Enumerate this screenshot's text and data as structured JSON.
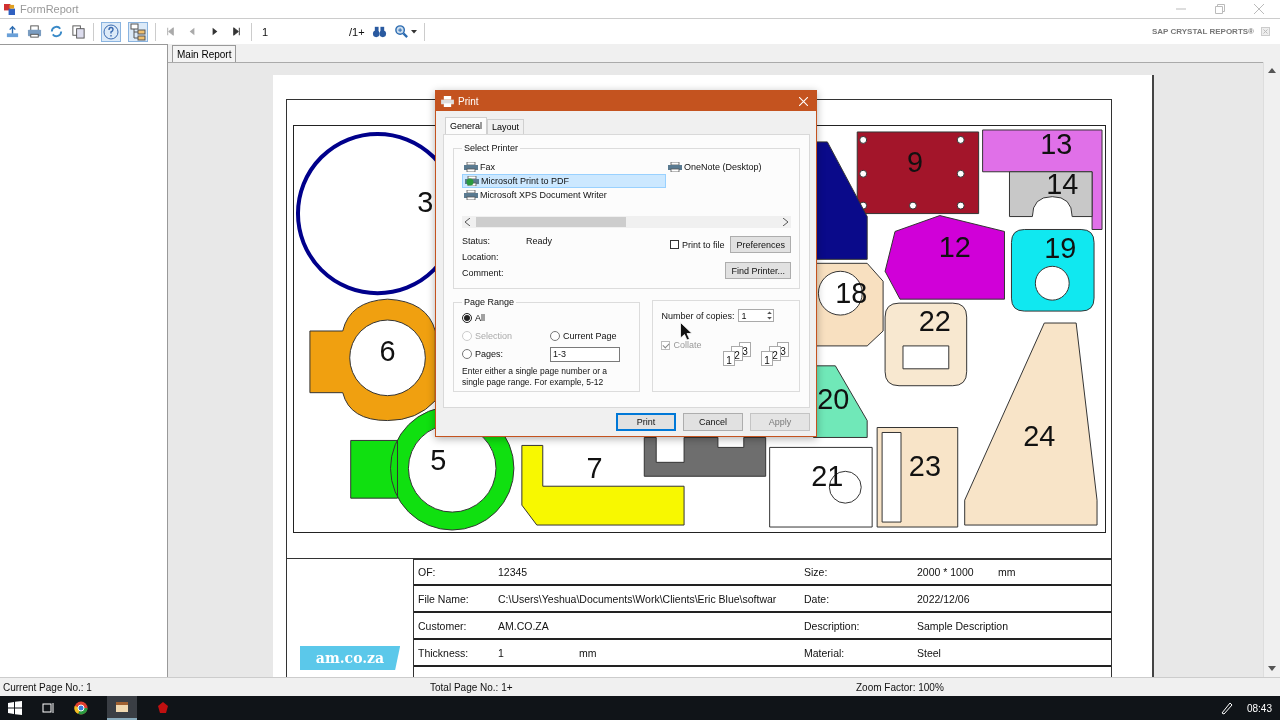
{
  "window": {
    "title": "FormReport"
  },
  "toolbar": {
    "page_field": "1",
    "page_count": "/1+",
    "brand": "SAP CRYSTAL REPORTS®"
  },
  "tabs": [
    {
      "label": "Main Report",
      "selected": true
    }
  ],
  "drawing": {
    "parts": [
      {
        "label": "3",
        "color": "#00008b"
      },
      {
        "label": "6",
        "color": "#f0a010"
      },
      {
        "label": "5",
        "color": "#10e010"
      },
      {
        "label": "7",
        "color": "#f8f800"
      },
      {
        "color": "#6e6e6e"
      },
      {
        "label": "9",
        "color": "#a3152a"
      },
      {
        "label": "13",
        "color": "#e070e8"
      },
      {
        "label": "14",
        "color": "#c8c8c8"
      },
      {
        "color": "#0a0a8a"
      },
      {
        "label": "12",
        "color": "#d000d8"
      },
      {
        "label": "19",
        "color": "#10e8f0"
      },
      {
        "label": "18",
        "color": "#f8e0c0"
      },
      {
        "label": "22",
        "color": "#f8e8d0"
      },
      {
        "label": "20",
        "color": "#70e8b8"
      },
      {
        "label": "24",
        "color": "#f8e4c8"
      },
      {
        "label": "21",
        "color": "#ffffff"
      },
      {
        "label": "23",
        "color": "#f8e4c8"
      }
    ]
  },
  "report_table": {
    "logo": "am.co.za",
    "rows": [
      {
        "label": "OF:",
        "value": "12345",
        "label_2": "Size:",
        "value_2": "2000 * 1000",
        "unit_2": "mm"
      },
      {
        "label": "File Name:",
        "value": "C:\\Users\\Yeshua\\Documents\\Work\\Clients\\Eric Blue\\softwar",
        "label_2": "Date:",
        "value_2": "2022/12/06"
      },
      {
        "label": "Customer:",
        "value": "AM.CO.ZA",
        "label_2": "Description:",
        "value_2": "Sample Description"
      },
      {
        "label": "Thickness:",
        "value": "1",
        "unit": "mm",
        "label_2": "Material:",
        "value_2": "Steel"
      }
    ]
  },
  "print_dialog": {
    "title": "Print",
    "tabs": [
      {
        "label": "General",
        "selected": true
      },
      {
        "label": "Layout",
        "selected": false
      }
    ],
    "select_printer": {
      "heading": "Select Printer",
      "printers": [
        {
          "name": "Fax",
          "selected": false
        },
        {
          "name": "Microsoft Print to PDF",
          "selected": true
        },
        {
          "name": "Microsoft XPS Document Writer",
          "selected": false
        },
        {
          "name": "OneNote (Desktop)",
          "selected": false
        }
      ],
      "info": [
        {
          "label": "Status:",
          "value": "Ready"
        },
        {
          "label": "Location:"
        },
        {
          "label": "Comment:"
        }
      ],
      "print_to_file": {
        "label": "Print to file",
        "checked": false
      },
      "preferences_button": "Preferences",
      "find_printer_button": "Find Printer..."
    },
    "page_range": {
      "heading": "Page Range",
      "options": [
        {
          "label": "All",
          "selected": true,
          "disabled": false
        },
        {
          "label": "Selection",
          "selected": false,
          "disabled": true
        },
        {
          "label": "Current Page",
          "selected": false,
          "disabled": false
        },
        {
          "label": "Pages:",
          "selected": false,
          "disabled": false
        }
      ],
      "pages_value": "1-3",
      "hint": "Enter either a single page number or a single page range.  For example, 5-12"
    },
    "copies": {
      "label": "Number of copies:",
      "value": "1",
      "collate": {
        "label": "Collate",
        "checked": true,
        "disabled": true
      },
      "collate_sets": [
        [
          "1",
          "2",
          "3"
        ],
        [
          "1",
          "2",
          "3"
        ]
      ]
    },
    "buttons": [
      {
        "label": "Print",
        "default": true,
        "disabled": false
      },
      {
        "label": "Cancel",
        "default": false,
        "disabled": false
      },
      {
        "label": "Apply",
        "default": false,
        "disabled": true
      }
    ]
  },
  "status_bar": [
    "Current Page No.: 1",
    "Total Page No.: 1+",
    "Zoom Factor: 100%"
  ],
  "taskbar": {
    "clock": "08:43"
  }
}
